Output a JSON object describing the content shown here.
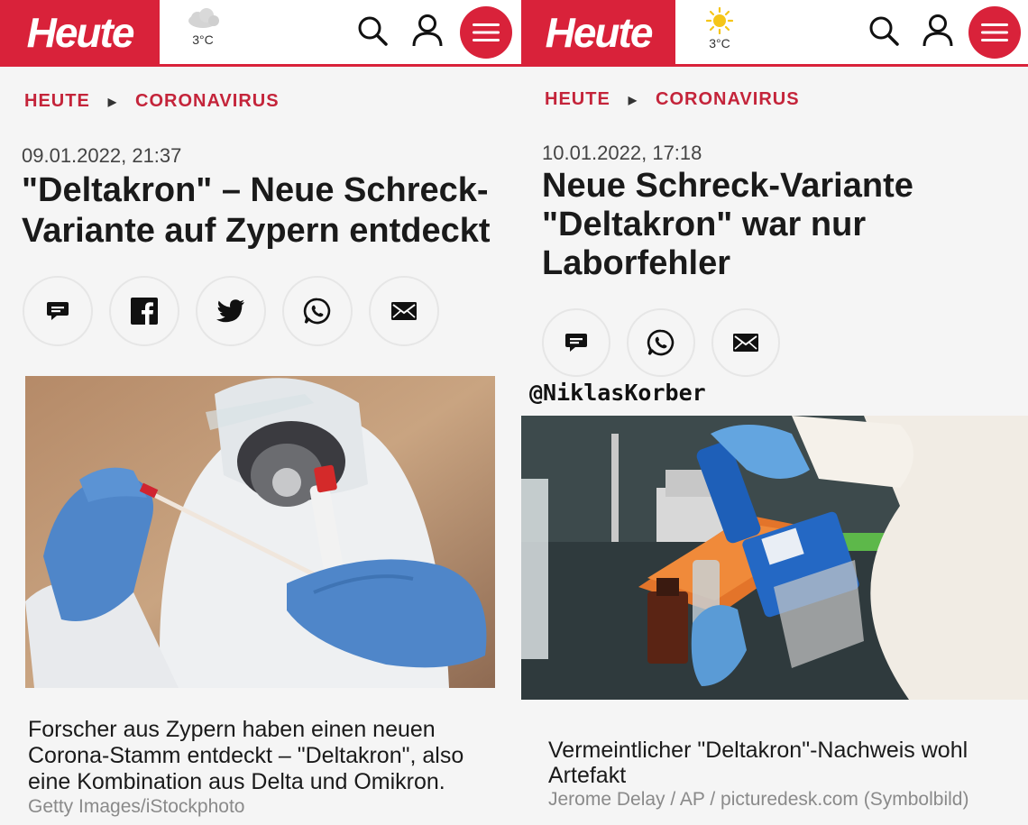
{
  "left": {
    "logo": "Heute",
    "weather": {
      "temp": "3°C",
      "icon": "cloud-icon"
    },
    "breadcrumb": [
      "HEUTE",
      "CORONAVIRUS"
    ],
    "date": "09.01.2022, 21:37",
    "headline": [
      "\"Deltakron\" – Neue Schreck-",
      "Variante auf Zypern entdeckt"
    ],
    "share": [
      "comment-icon",
      "facebook-icon",
      "twitter-icon",
      "whatsapp-icon",
      "mail-icon"
    ],
    "caption": [
      "Forscher aus Zypern haben einen neuen",
      "Corona-Stamm entdeckt – \"Deltakron\", also",
      "eine Kombination aus Delta und Omikron."
    ],
    "credit": "Getty Images/iStockphoto"
  },
  "right": {
    "logo": "Heute",
    "weather": {
      "temp": "3°C",
      "icon": "sun-icon"
    },
    "breadcrumb": [
      "HEUTE",
      "CORONAVIRUS"
    ],
    "date": "10.01.2022, 17:18",
    "headline": [
      "Neue Schreck-Variante",
      "\"Deltakron\" war nur",
      "Laborfehler"
    ],
    "share": [
      "comment-icon",
      "whatsapp-icon",
      "mail-icon"
    ],
    "watermark": "@NiklasKorber",
    "caption": [
      "Vermeintlicher \"Deltakron\"-Nachweis wohl",
      "Artefakt"
    ],
    "credit": "Jerome Delay / AP / picturedesk.com (Symbolbild)"
  },
  "colors": {
    "brand": "#d9223a"
  }
}
